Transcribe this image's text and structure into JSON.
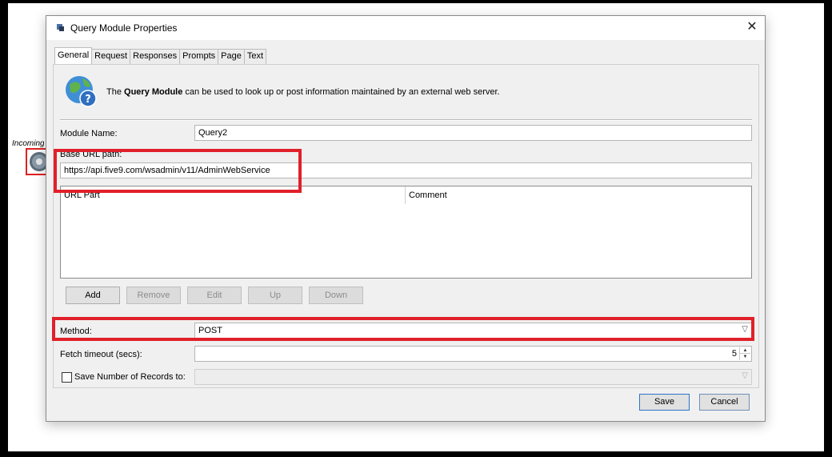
{
  "background": {
    "canvas_label": "Incoming"
  },
  "dialog": {
    "title": "Query Module Properties",
    "tabs": [
      "General",
      "Request",
      "Responses",
      "Prompts",
      "Page",
      "Text"
    ],
    "active_tab": "General",
    "intro": {
      "prefix": "The ",
      "bold": "Query Module",
      "suffix": " can be used to look up or post information maintained by an external web server."
    },
    "module_name": {
      "label": "Module Name:",
      "value": "Query2"
    },
    "base_url": {
      "label": "Base URL path:",
      "value": "https://api.five9.com/wsadmin/v11/AdminWebService"
    },
    "url_table": {
      "columns": [
        "URL Part",
        "Comment"
      ]
    },
    "table_buttons": {
      "add": "Add",
      "remove": "Remove",
      "edit": "Edit",
      "up": "Up",
      "down": "Down"
    },
    "method": {
      "label": "Method:",
      "value": "POST"
    },
    "fetch_timeout": {
      "label": "Fetch timeout (secs):",
      "value": "5"
    },
    "save_records": {
      "label": "Save Number of Records to:",
      "checked": false,
      "value": ""
    },
    "footer": {
      "save": "Save",
      "cancel": "Cancel"
    }
  },
  "colors": {
    "highlight": "#e0202a",
    "focus_border": "#2b74c9"
  }
}
